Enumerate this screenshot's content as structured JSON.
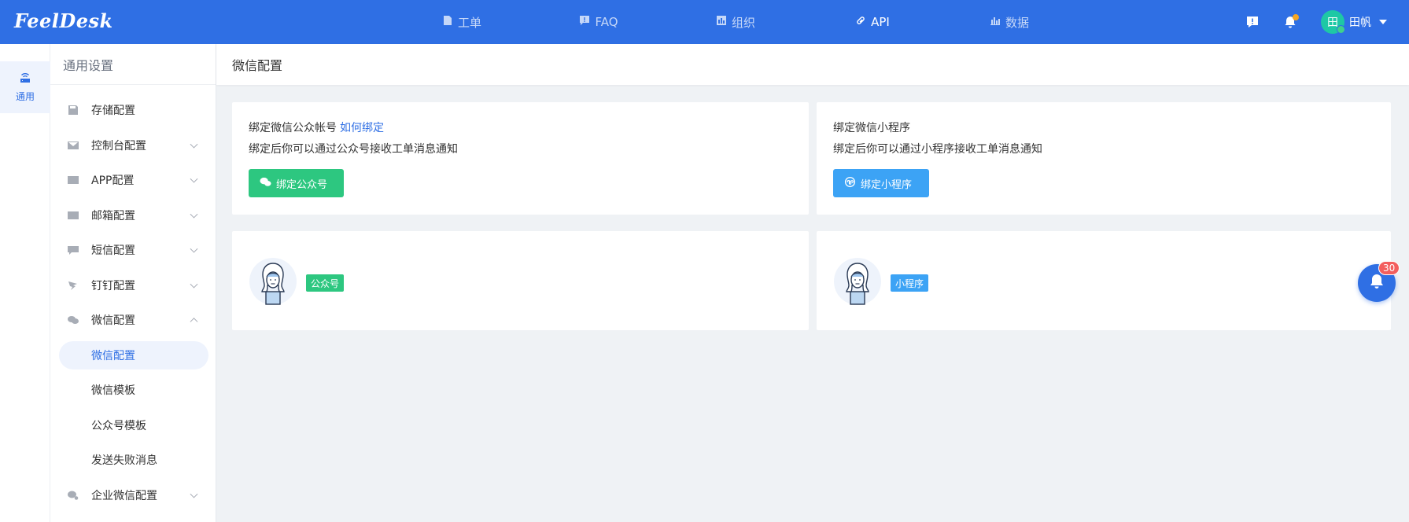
{
  "app": {
    "logo": "FeelDesk"
  },
  "topnav": [
    {
      "label": "工单",
      "icon": "ticket-icon",
      "active": false
    },
    {
      "label": "FAQ",
      "icon": "faq-icon",
      "active": false
    },
    {
      "label": "组织",
      "icon": "org-icon",
      "active": false
    },
    {
      "label": "API",
      "icon": "link-icon",
      "active": true
    },
    {
      "label": "数据",
      "icon": "chart-icon",
      "active": false
    }
  ],
  "user": {
    "avatar_text": "田",
    "name": "田帆"
  },
  "rail": {
    "label": "通用"
  },
  "sidebar": {
    "title": "通用设置",
    "items": [
      {
        "label": "存储配置"
      },
      {
        "label": "控制台配置"
      },
      {
        "label": "APP配置"
      },
      {
        "label": "邮箱配置"
      },
      {
        "label": "短信配置"
      },
      {
        "label": "钉钉配置"
      },
      {
        "label": "微信配置"
      }
    ],
    "sub_items": [
      {
        "label": "微信配置",
        "active": true
      },
      {
        "label": "微信模板"
      },
      {
        "label": "公众号模板"
      },
      {
        "label": "发送失败消息"
      }
    ],
    "last_item": {
      "label": "企业微信配置"
    }
  },
  "content": {
    "title": "微信配置",
    "card_official": {
      "line1": "绑定微信公众帐号",
      "link": "如何绑定",
      "line2": "绑定后你可以通过公众号接收工单消息通知",
      "button": "绑定公众号"
    },
    "card_mini": {
      "line1": "绑定微信小程序",
      "line2": "绑定后你可以通过小程序接收工单消息通知",
      "button": "绑定小程序"
    },
    "tag_official": "公众号",
    "tag_mini": "小程序"
  },
  "notifications": {
    "count": "30"
  },
  "colors": {
    "brand": "#2f6fe4",
    "green": "#2dc780",
    "blue": "#3ca3f5",
    "badge": "#f35e5e"
  }
}
